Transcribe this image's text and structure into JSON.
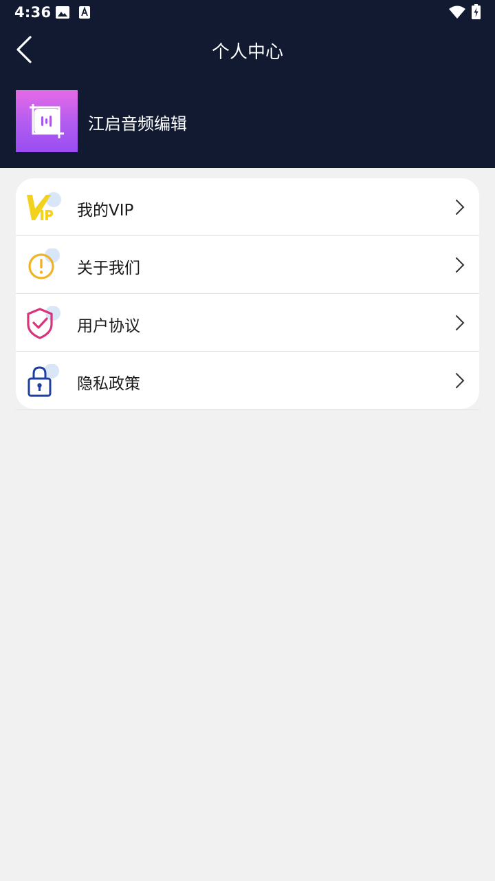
{
  "status_bar": {
    "time": "4:36",
    "icons": [
      "image-icon",
      "font-download-icon",
      "wifi-icon",
      "battery-charging-icon"
    ]
  },
  "nav": {
    "back_icon": "back-arrow-icon",
    "title": "个人中心"
  },
  "profile": {
    "app_name": "江启音频编辑",
    "logo_icon": "audio-crop-icon"
  },
  "menu": {
    "items": [
      {
        "label": "我的VIP",
        "icon": "vip-icon"
      },
      {
        "label": "关于我们",
        "icon": "info-icon"
      },
      {
        "label": "用户协议",
        "icon": "shield-check-icon"
      },
      {
        "label": "隐私政策",
        "icon": "lock-icon"
      }
    ]
  },
  "colors": {
    "header_bg": "#111a31",
    "page_bg": "#f1f1f1",
    "vip_yellow": "#f2d21c",
    "info_orange": "#f0b323",
    "shield_pink": "#d8347a",
    "lock_blue": "#1f3fa0",
    "icon_bubble": "#d9e6f7"
  }
}
